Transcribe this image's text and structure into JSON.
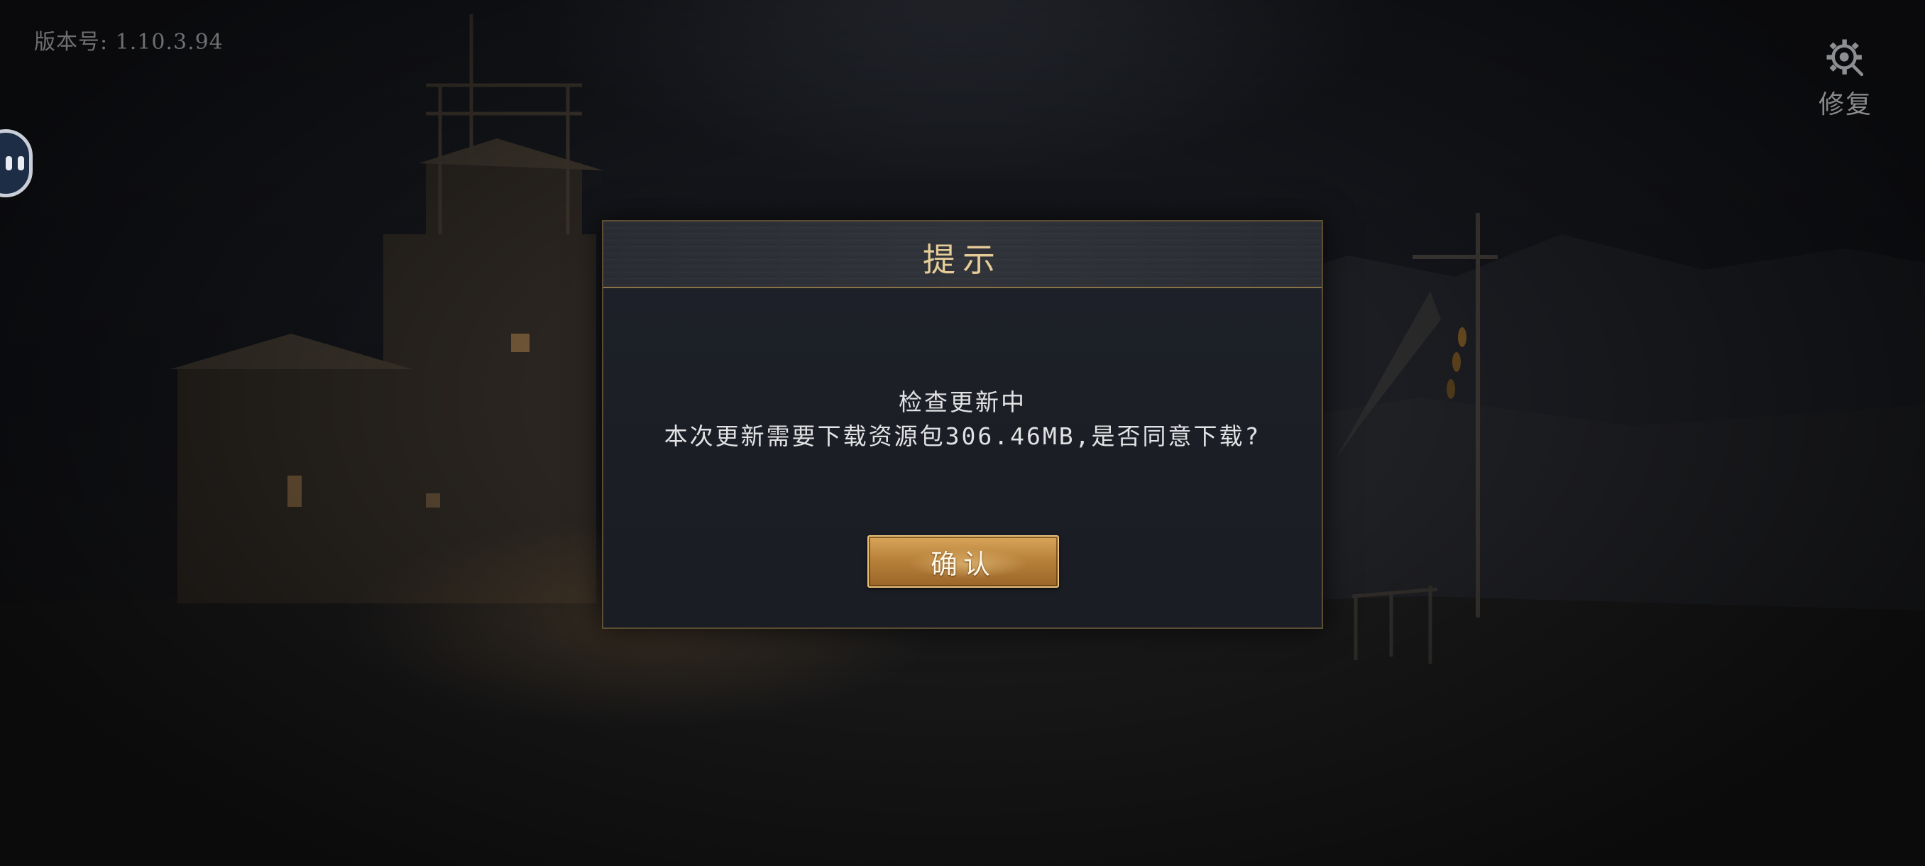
{
  "version_label": "版本号: 1.10.3.94",
  "repair": {
    "icon": "repair-gear-magnifier-icon",
    "label": "修复"
  },
  "floating_button": {
    "icon": "assistive-face-icon"
  },
  "dialog": {
    "title": "提示",
    "line1": "检查更新中",
    "line2": "本次更新需要下载资源包306.46MB,是否同意下载?",
    "confirm_label": "确认"
  },
  "colors": {
    "title_gold": "#e6cc98",
    "button_gold": "#c08a43",
    "dialog_bg": "#1c1f26"
  }
}
